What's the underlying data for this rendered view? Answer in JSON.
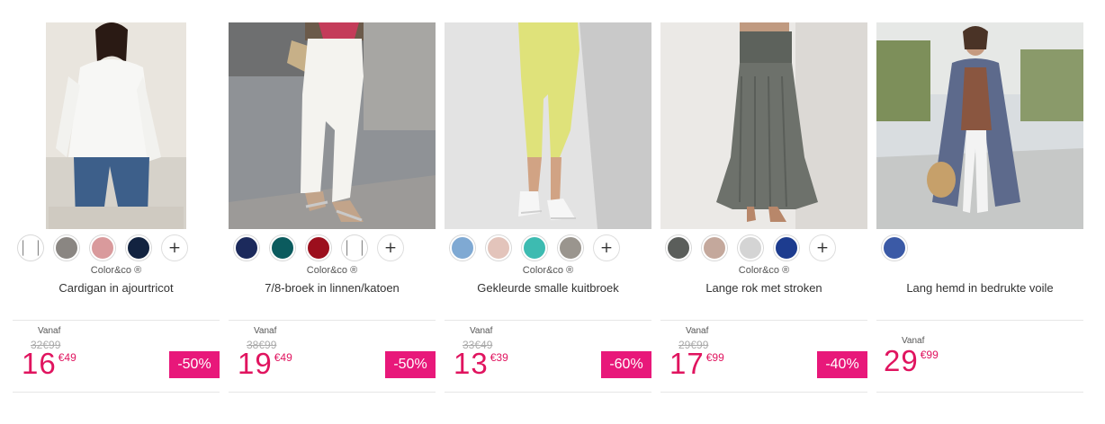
{
  "products": [
    {
      "brand": "Color&co ®",
      "title": "Cardigan in ajourtricot",
      "vanaf": "Vanaf",
      "old_price": "32€99",
      "price_int": "16",
      "price_dec": "€49",
      "discount": "-50%",
      "swatches": [
        "#ffffff",
        "#8a8682",
        "#d99a9c",
        "#122340"
      ],
      "swatch_selected_white": true
    },
    {
      "brand": "Color&co ®",
      "title": "7/8-broek in linnen/katoen",
      "vanaf": "Vanaf",
      "old_price": "38€99",
      "price_int": "19",
      "price_dec": "€49",
      "discount": "-50%",
      "swatches": [
        "#1c2a5c",
        "#0b5b5e",
        "#9c0f1d",
        "#ffffff"
      ],
      "swatch_selected_white": true
    },
    {
      "brand": "Color&co ®",
      "title": "Gekleurde smalle kuitbroek",
      "vanaf": "Vanaf",
      "old_price": "33€49",
      "price_int": "13",
      "price_dec": "€39",
      "discount": "-60%",
      "swatches": [
        "#7fa9d3",
        "#e3c4bb",
        "#3dbbb1",
        "#9a958e"
      ]
    },
    {
      "brand": "Color&co ®",
      "title": "Lange rok met stroken",
      "vanaf": "Vanaf",
      "old_price": "29€99",
      "price_int": "17",
      "price_dec": "€99",
      "discount": "-40%",
      "swatches": [
        "#5b5e5b",
        "#c4a89c",
        "#d4d4d4",
        "#1d3c8f"
      ]
    },
    {
      "brand": "",
      "title": "Lang hemd in bedrukte voile",
      "vanaf": "Vanaf",
      "old_price": "",
      "price_int": "29",
      "price_dec": "€99",
      "discount": "",
      "swatches": [
        "#3b5aa6"
      ]
    }
  ],
  "more_colors_icon": "plus-icon",
  "more_colors_label": "+",
  "accent_color": "#e0145f"
}
